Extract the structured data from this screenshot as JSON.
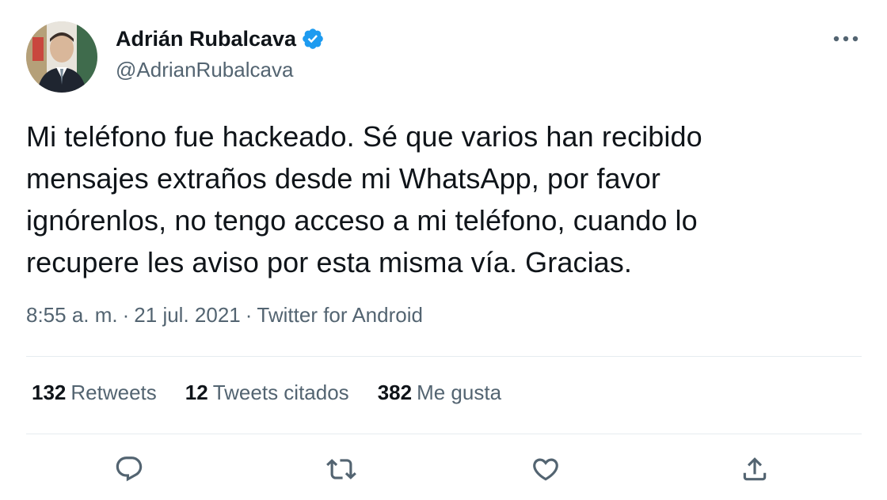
{
  "author": {
    "display_name": "Adrián Rubalcava",
    "handle": "@AdrianRubalcava"
  },
  "tweet": {
    "text": "Mi teléfono fue hackeado. Sé que varios han recibido\nmensajes extraños desde mi WhatsApp, por favor\nignórenlos, no tengo acceso a mi teléfono, cuando lo\nrecupere les aviso por esta misma vía. Gracias.",
    "time": "8:55 a. m.",
    "separator": "·",
    "date": "21 jul. 2021",
    "source": "Twitter for Android"
  },
  "stats": {
    "retweets_count": "132",
    "retweets_label": "Retweets",
    "quotes_count": "12",
    "quotes_label": "Tweets citados",
    "likes_count": "382",
    "likes_label": "Me gusta"
  },
  "icons": {
    "verified": "verified-badge-icon",
    "more": "more-options-icon",
    "reply": "reply-icon",
    "retweet": "retweet-icon",
    "like": "heart-icon",
    "share": "share-icon"
  },
  "colors": {
    "verified_blue": "#1d9bf0",
    "text_primary": "#0f1419",
    "text_secondary": "#536471",
    "divider": "#e6ecf0"
  }
}
